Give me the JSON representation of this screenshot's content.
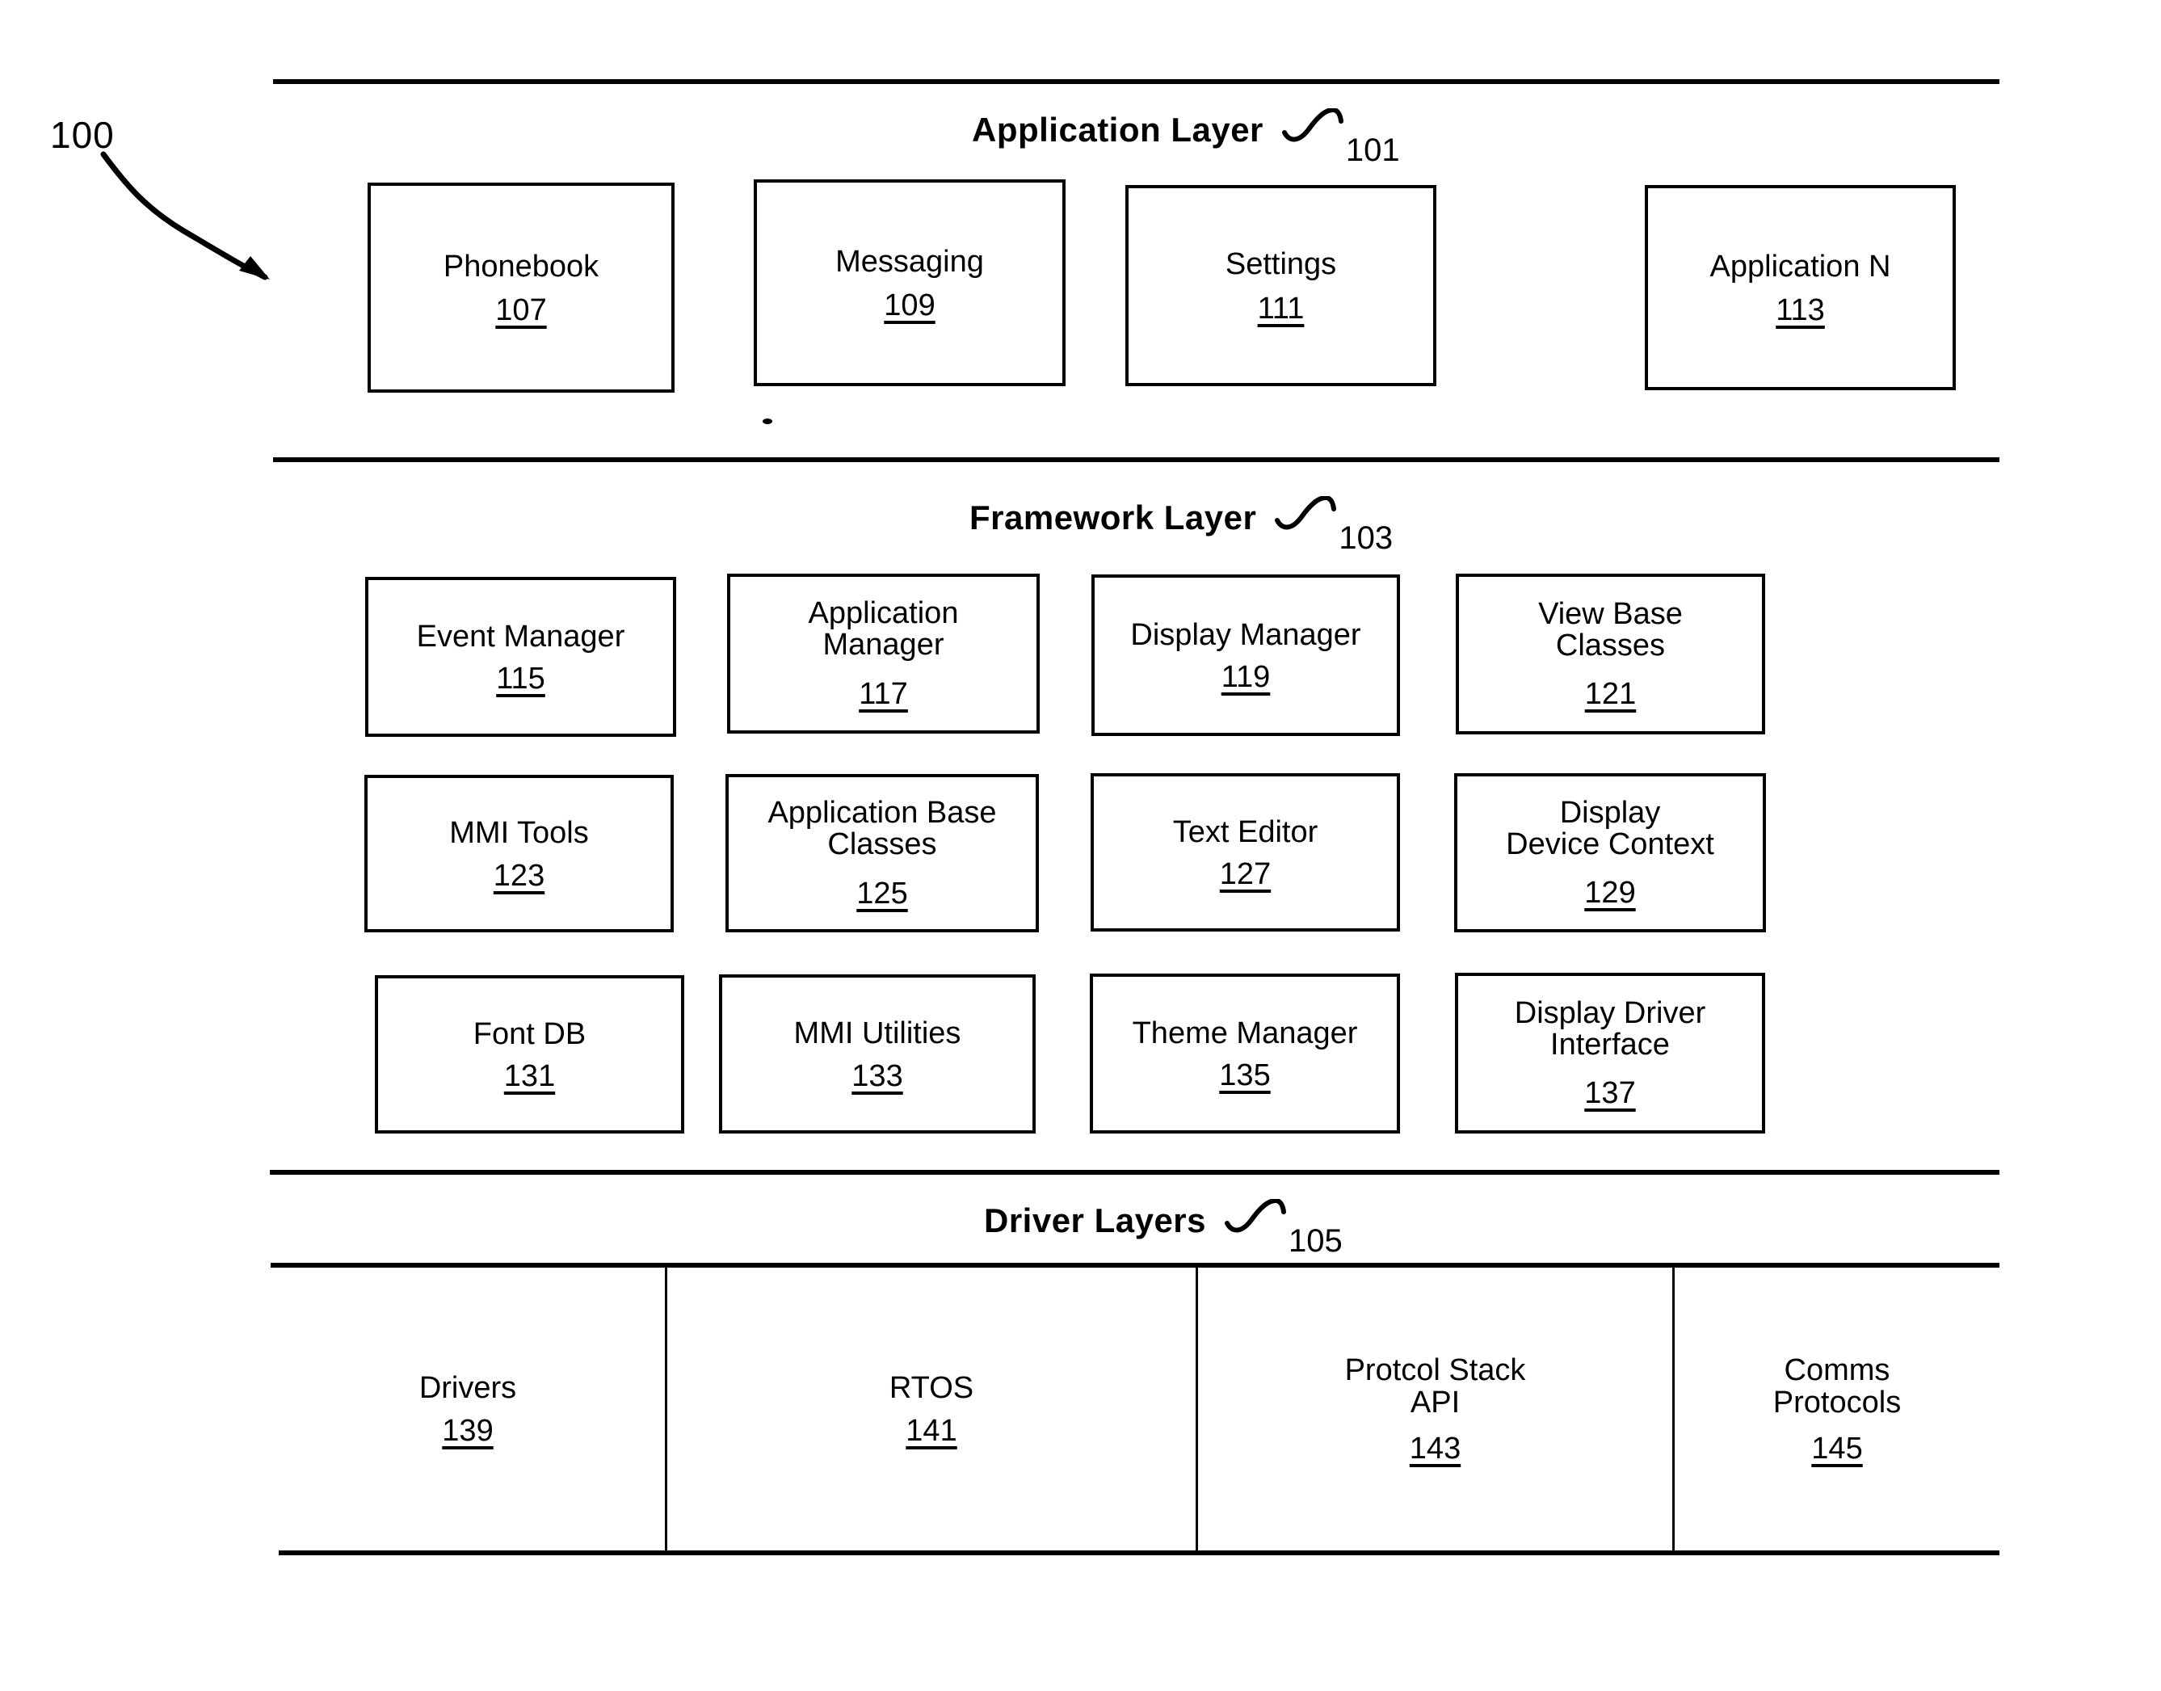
{
  "figure": {
    "reference_number": "100"
  },
  "layers": [
    {
      "id": "application",
      "title": "Application Layer",
      "ref": "101",
      "blocks": [
        {
          "label": "Phonebook",
          "ref": "107"
        },
        {
          "label": "Messaging",
          "ref": "109"
        },
        {
          "label": "Settings",
          "ref": "111"
        },
        {
          "label": "Application N",
          "ref": "113"
        }
      ]
    },
    {
      "id": "framework",
      "title": "Framework Layer",
      "ref": "103",
      "blocks": [
        {
          "label": "Event Manager",
          "ref": "115"
        },
        {
          "label": "Application\nManager",
          "ref": "117"
        },
        {
          "label": "Display Manager",
          "ref": "119"
        },
        {
          "label": "View Base\nClasses",
          "ref": "121"
        },
        {
          "label": "MMI Tools",
          "ref": "123"
        },
        {
          "label": "Application Base\nClasses",
          "ref": "125"
        },
        {
          "label": "Text Editor",
          "ref": "127"
        },
        {
          "label": "Display\nDevice Context",
          "ref": "129"
        },
        {
          "label": "Font DB",
          "ref": "131"
        },
        {
          "label": "MMI Utilities",
          "ref": "133"
        },
        {
          "label": "Theme Manager",
          "ref": "135"
        },
        {
          "label": "Display Driver\nInterface",
          "ref": "137"
        }
      ]
    },
    {
      "id": "driver",
      "title": "Driver Layers",
      "ref": "105",
      "blocks": [
        {
          "label": "Drivers",
          "ref": "139"
        },
        {
          "label": "RTOS",
          "ref": "141"
        },
        {
          "label": "Protcol Stack\nAPI",
          "ref": "143"
        },
        {
          "label": "Comms\nProtocols",
          "ref": "145"
        }
      ]
    }
  ],
  "colors": {
    "ink": "#000000",
    "paper": "#ffffff"
  }
}
